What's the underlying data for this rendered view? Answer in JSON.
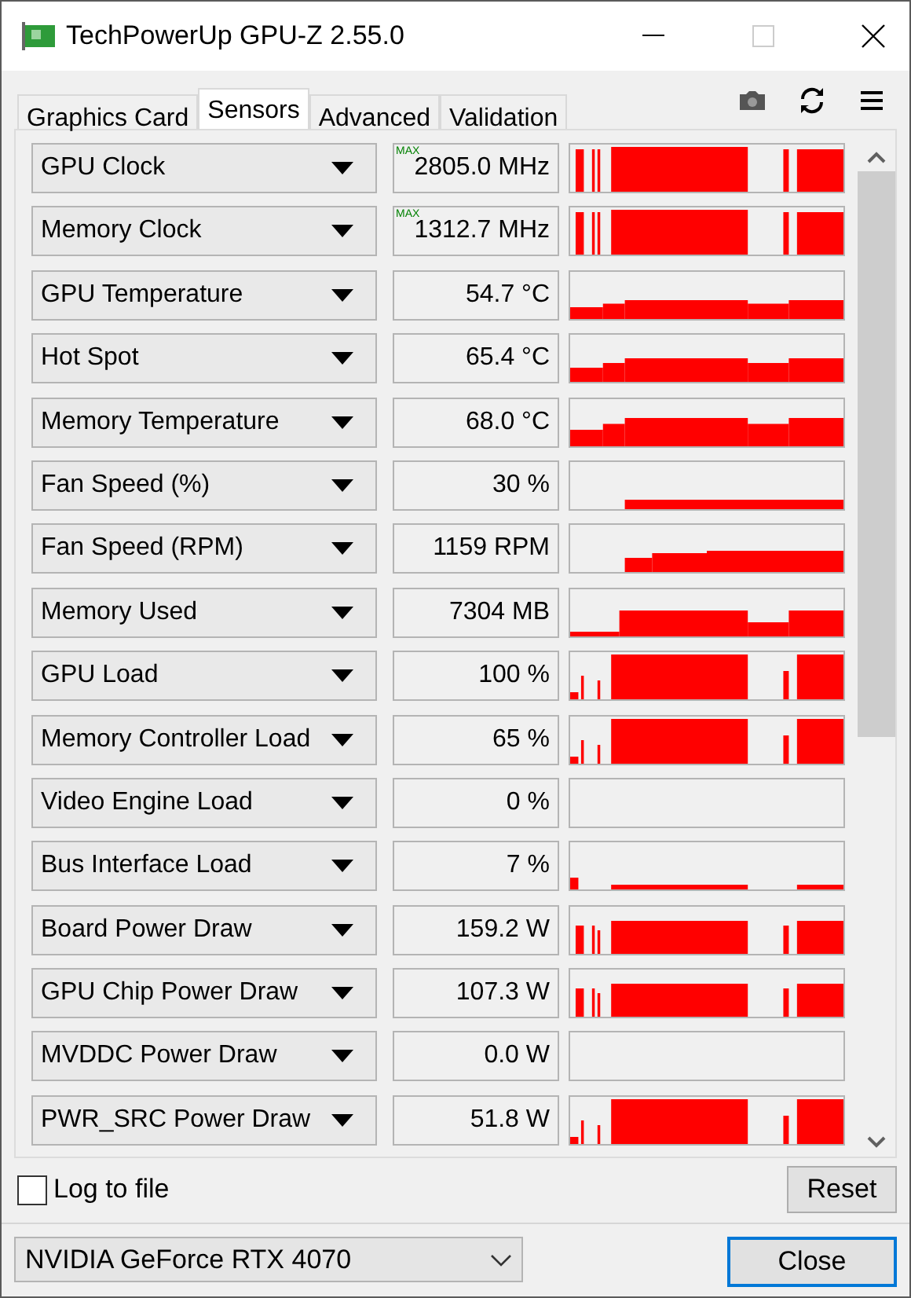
{
  "window": {
    "title": "TechPowerUp GPU-Z 2.55.0"
  },
  "tabs": [
    {
      "label": "Graphics Card",
      "selected": false
    },
    {
      "label": "Sensors",
      "selected": true
    },
    {
      "label": "Advanced",
      "selected": false
    },
    {
      "label": "Validation",
      "selected": false
    }
  ],
  "sensors": [
    {
      "name": "GPU Clock",
      "badge": "MAX",
      "reading": "2805.0 MHz"
    },
    {
      "name": "Memory Clock",
      "badge": "MAX",
      "reading": "1312.7 MHz"
    },
    {
      "name": "GPU Temperature",
      "reading": "54.7 °C"
    },
    {
      "name": "Hot Spot",
      "reading": "65.4 °C"
    },
    {
      "name": "Memory Temperature",
      "reading": "68.0 °C"
    },
    {
      "name": "Fan Speed (%)",
      "reading": "30 %"
    },
    {
      "name": "Fan Speed (RPM)",
      "reading": "1159 RPM"
    },
    {
      "name": "Memory Used",
      "reading": "7304 MB"
    },
    {
      "name": "GPU Load",
      "reading": "100 %"
    },
    {
      "name": "Memory Controller Load",
      "reading": "65 %"
    },
    {
      "name": "Video Engine Load",
      "reading": "0 %"
    },
    {
      "name": "Bus Interface Load",
      "reading": "7 %"
    },
    {
      "name": "Board Power Draw",
      "reading": "159.2 W"
    },
    {
      "name": "GPU Chip Power Draw",
      "reading": "107.3 W"
    },
    {
      "name": "MVDDC Power Draw",
      "reading": "0.0 W"
    },
    {
      "name": "PWR_SRC Power Draw",
      "reading": "51.8 W"
    }
  ],
  "log_to_file": {
    "label": "Log to file",
    "checked": false
  },
  "reset_button": "Reset",
  "device_select": {
    "value": "NVIDIA GeForce RTX 4070"
  },
  "close_button": "Close"
}
